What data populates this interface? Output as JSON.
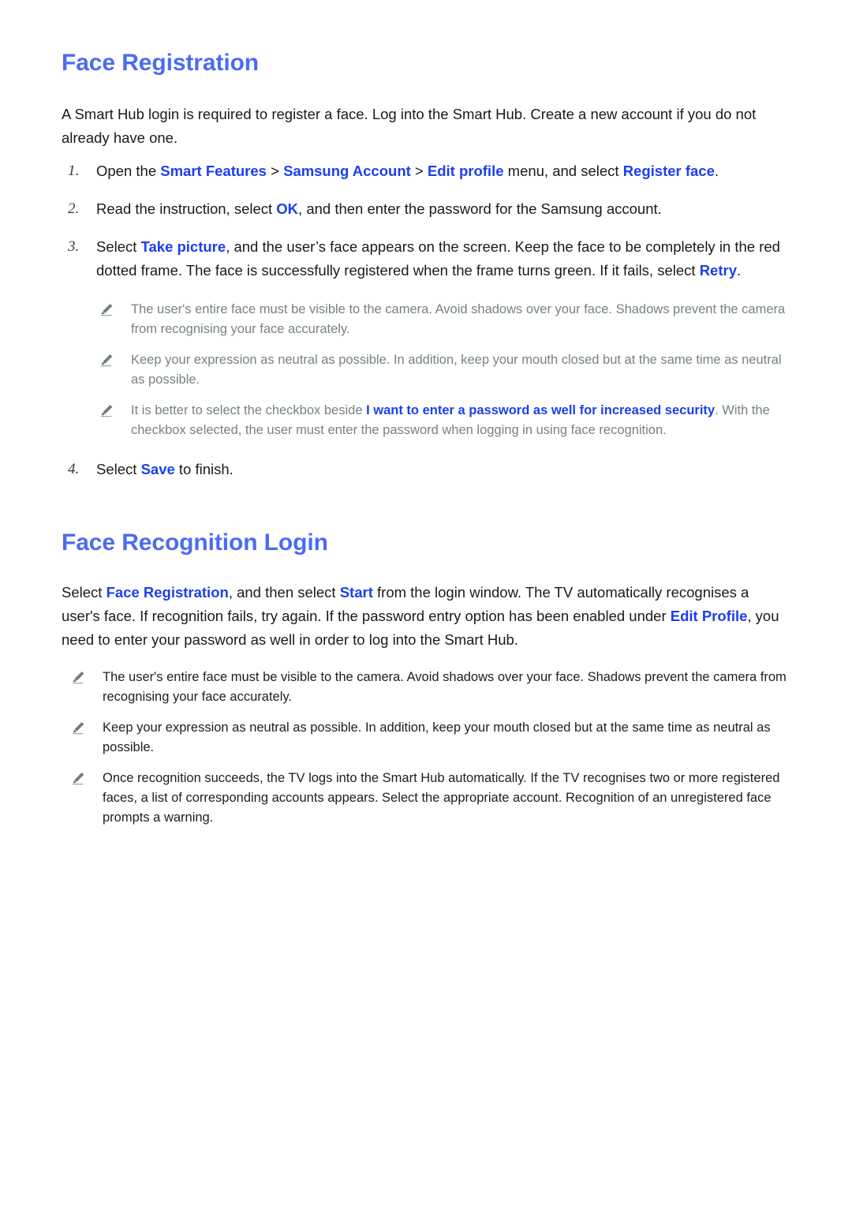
{
  "colors": {
    "heading_blue": "#4a6cf0",
    "link_blue": "#1b3ff0",
    "body_text": "#1a1a1a",
    "note_muted": "#76837f",
    "note_dark": "#1e1e1e",
    "page_background": "#ffffff"
  },
  "section_one": {
    "heading": "Face Registration",
    "intro": "A Smart Hub login is required to register a face. Log into the Smart Hub. Create a new account if you do not already have one.",
    "steps": [
      {
        "number": "1.",
        "parts": [
          {
            "text": "Open the ",
            "style": "plain"
          },
          {
            "text": "Smart Features",
            "style": "link"
          },
          {
            "text": " > ",
            "style": "plain"
          },
          {
            "text": "Samsung Account",
            "style": "link"
          },
          {
            "text": " > ",
            "style": "plain"
          },
          {
            "text": "Edit profile",
            "style": "link"
          },
          {
            "text": " menu, and select ",
            "style": "plain"
          },
          {
            "text": "Register face",
            "style": "link"
          },
          {
            "text": ".",
            "style": "plain"
          }
        ]
      },
      {
        "number": "2.",
        "parts": [
          {
            "text": "Read the instruction, select ",
            "style": "plain"
          },
          {
            "text": "OK",
            "style": "link"
          },
          {
            "text": ", and then enter the password for the Samsung account.",
            "style": "plain"
          }
        ]
      },
      {
        "number": "3.",
        "parts": [
          {
            "text": "Select ",
            "style": "plain"
          },
          {
            "text": "Take picture",
            "style": "link"
          },
          {
            "text": ", and the user’s face appears on the screen. Keep the face to be completely in the red dotted frame. The face is successfully registered when the frame turns green. If it fails, select ",
            "style": "plain"
          },
          {
            "text": "Retry",
            "style": "link"
          },
          {
            "text": ".",
            "style": "plain"
          }
        ]
      },
      {
        "number": "4.",
        "parts": [
          {
            "text": "Select ",
            "style": "plain"
          },
          {
            "text": "Save",
            "style": "link"
          },
          {
            "text": " to finish.",
            "style": "plain"
          }
        ]
      }
    ],
    "notes": [
      {
        "icon": "pencil-icon",
        "parts": [
          {
            "text": "The user's entire face must be visible to the camera. Avoid shadows over your face. Shadows prevent the camera from recognising your face accurately.",
            "style": "plain"
          }
        ]
      },
      {
        "icon": "pencil-icon",
        "parts": [
          {
            "text": "Keep your expression as neutral as possible. In addition, keep your mouth closed but at the same time as neutral as possible.",
            "style": "plain"
          }
        ]
      },
      {
        "icon": "pencil-icon",
        "parts": [
          {
            "text": "It is better to select the checkbox beside ",
            "style": "plain"
          },
          {
            "text": "I want to enter a password as well for increased security",
            "style": "link"
          },
          {
            "text": ". With the checkbox selected, the user must enter the password when logging in using face recognition.",
            "style": "plain"
          }
        ]
      }
    ]
  },
  "section_two": {
    "heading": "Face Recognition Login",
    "paragraph_parts": [
      {
        "text": "Select ",
        "style": "plain"
      },
      {
        "text": "Face Registration",
        "style": "link"
      },
      {
        "text": ", and then select ",
        "style": "plain"
      },
      {
        "text": "Start",
        "style": "link"
      },
      {
        "text": " from the login window. The TV automatically recognises a user's face. If recognition fails, try again. If the password entry option has been enabled under ",
        "style": "plain"
      },
      {
        "text": "Edit Profile",
        "style": "link"
      },
      {
        "text": ", you need to enter your password as well in order to log into the Smart Hub.",
        "style": "plain"
      }
    ],
    "notes": [
      {
        "icon": "pencil-icon",
        "parts": [
          {
            "text": "The user's entire face must be visible to the camera. Avoid shadows over your face. Shadows prevent the camera from recognising your face accurately.",
            "style": "plain"
          }
        ]
      },
      {
        "icon": "pencil-icon",
        "parts": [
          {
            "text": "Keep your expression as neutral as possible. In addition, keep your mouth closed but at the same time as neutral as possible.",
            "style": "plain"
          }
        ]
      },
      {
        "icon": "pencil-icon",
        "parts": [
          {
            "text": "Once recognition succeeds, the TV logs into the Smart Hub automatically. If the TV recognises two or more registered faces, a list of corresponding accounts appears. Select the appropriate account. Recognition of an unregistered face prompts a warning.",
            "style": "plain"
          }
        ]
      }
    ]
  }
}
